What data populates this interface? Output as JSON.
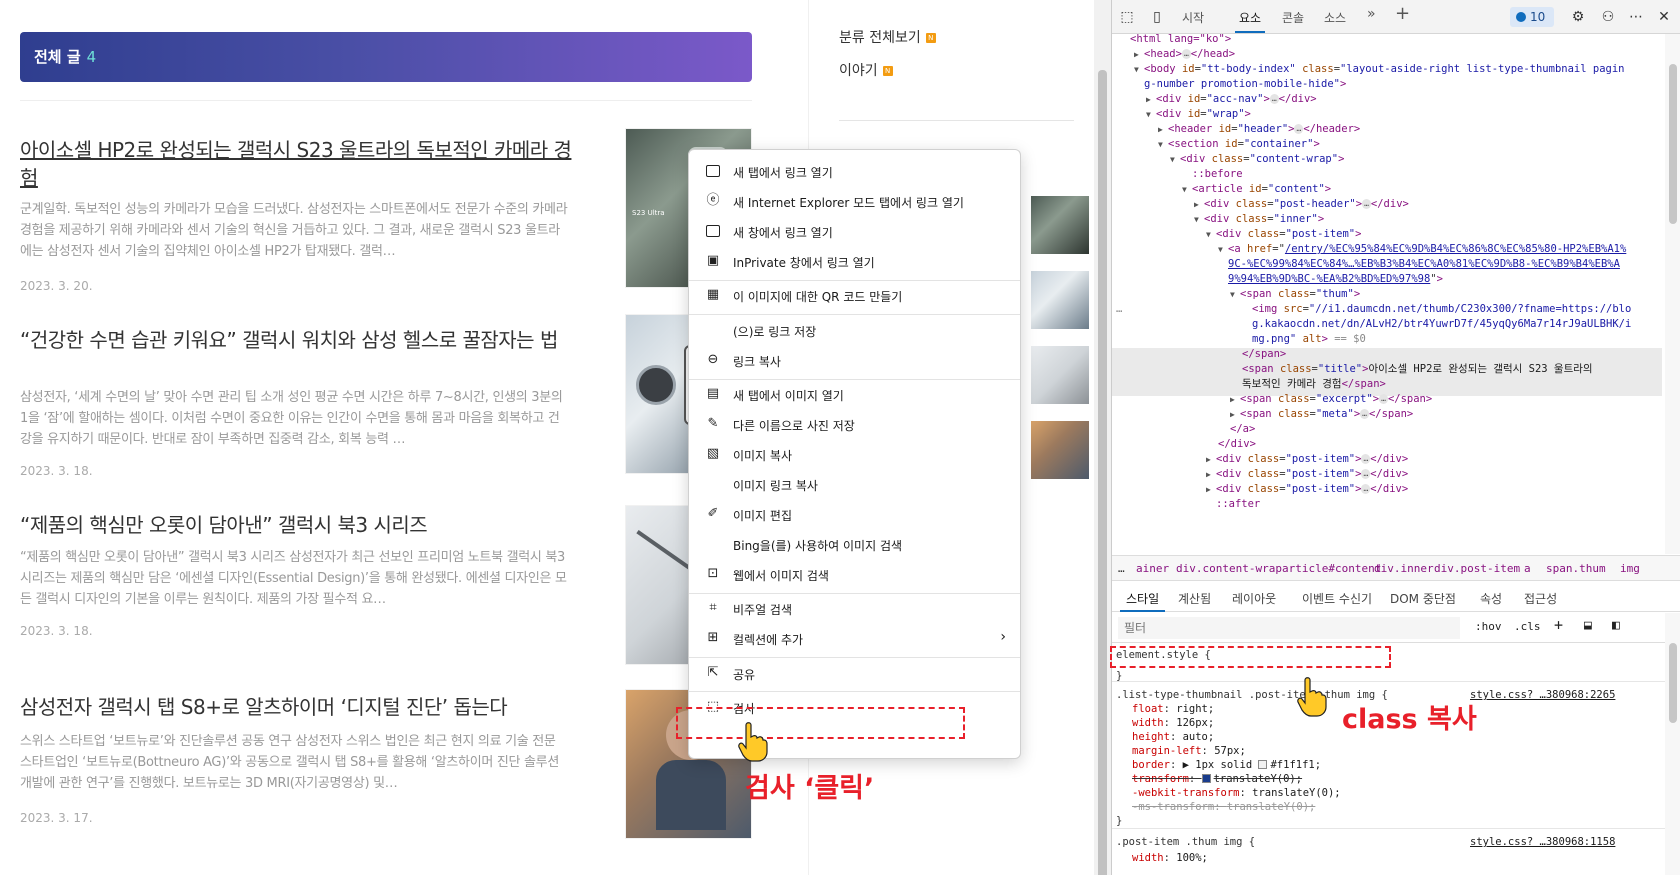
{
  "blog": {
    "banner": {
      "title": "전체 글",
      "count": "4"
    },
    "posts": [
      {
        "title": "아이소셀 HP2로 완성되는 갤럭시 S23 울트라의 독보적인 카메라 경험",
        "excerpt": "군계일학. 독보적인 성능의 카메라가 모습을 드러냈다. 삼성전자는 스마트폰에서도 전문가 수준의 카메라 경험을 제공하기 위해 카메라와 센서 기술의 혁신을 거듭하고 있다. 그 결과, 새로운 갤럭시 S23 울트라에는 삼성전자 센서 기술의 집약체인 아이소셀 HP2가 탑재됐다. 갤럭…",
        "date": "2023. 3. 20.",
        "thumb_label": "S23 Ultra"
      },
      {
        "title": "“건강한 수면 습관 키워요” 갤럭시 워치와 삼성 헬스로 꿀잠자는 법",
        "excerpt": "삼성전자, ‘세계 수면의 날’ 맞아 수면 관리 팁 소개 성인 평균 수면 시간은 하루 7~8시간, 인생의 3분의 1을 ‘잠’에 할애하는 셈이다. 이처럼 수면이 중요한 이유는 인간이 수면을 통해 몸과 마음을 회복하고 건강을 유지하기 때문이다. 반대로 잠이 부족하면 집중력 감소, 회복 능력 …",
        "date": "2023. 3. 18."
      },
      {
        "title": "“제품의 핵심만 오롯이 담아낸” 갤럭시 북3 시리즈",
        "excerpt": "“제품의 핵심만 오롯이 담아낸” 갤럭시 북3 시리즈 삼성전자가 최근 선보인 프리미엄 노트북 갤럭시 북3 시리즈는 제품의 핵심만 담은 ‘에센셜 디자인(Essential Design)’을 통해 완성됐다. 에센셜 디자인은 모든 갤럭시 디자인의 기본을 이루는 원칙이다. 제품의 가장 필수적 요…",
        "date": "2023. 3. 18."
      },
      {
        "title": "삼성전자 갤럭시 탭 S8+로 알츠하이머 ‘디지털 진단’ 돕는다",
        "excerpt": "스위스 스타트업 ‘보트뉴로’와 진단솔루션 공동 연구 삼성전자 스위스 법인은 최근 현지 의료 기술 전문 스타트업인 ‘보트뉴로(Bottneuro AG)’와 공동으로 갤럭시 탭 S8+를 활용해 ‘알츠하이머 진단 솔루션 개발에 관한 연구’를 진행했다. 보트뉴로는 3D MRI(자기공명영상) 및…",
        "date": "2023. 3. 17."
      }
    ],
    "sidebar": {
      "category_all": "분류 전체보기",
      "category_story": "이야기",
      "new_badge": "N"
    }
  },
  "context_menu": {
    "items": [
      {
        "label": "새 탭에서 링크 열기",
        "icon": "new-tab-icon"
      },
      {
        "label": "새 Internet Explorer 모드 탭에서 링크 열기",
        "icon": "ie-icon"
      },
      {
        "label": "새 창에서 링크 열기",
        "icon": "new-window-icon"
      },
      {
        "label": "InPrivate 창에서 링크 열기",
        "icon": "inprivate-icon"
      },
      {
        "label": "이 이미지에 대한 QR 코드 만들기",
        "icon": "qr-icon"
      },
      {
        "label": "(으)로 링크 저장",
        "icon": ""
      },
      {
        "label": "링크 복사",
        "icon": "link-icon"
      },
      {
        "label": "새 탭에서 이미지 열기",
        "icon": "image-tab-icon"
      },
      {
        "label": "다른 이름으로 사진 저장",
        "icon": "save-image-icon"
      },
      {
        "label": "이미지 복사",
        "icon": "copy-image-icon"
      },
      {
        "label": "이미지 링크 복사",
        "icon": ""
      },
      {
        "label": "이미지 편집",
        "icon": "edit-image-icon"
      },
      {
        "label": "Bing을(를) 사용하여 이미지 검색",
        "icon": ""
      },
      {
        "label": "웹에서 이미지 검색",
        "icon": "web-image-search-icon"
      },
      {
        "label": "비주얼 검색",
        "icon": "visual-search-icon"
      },
      {
        "label": "컬렉션에 추가",
        "icon": "collections-icon"
      },
      {
        "label": "공유",
        "icon": "share-icon"
      },
      {
        "label": "검사",
        "icon": "inspect-icon"
      }
    ],
    "submenu_arrow": "›"
  },
  "annotations": {
    "inspect_click": "검사 ‘클릭’",
    "copy_class": "class 복사",
    "color": "#e8202a"
  },
  "devtools": {
    "tabs": [
      "시작",
      "요소",
      "콘솔",
      "소스"
    ],
    "active_tab": "요소",
    "more": "»",
    "add": "+",
    "issues_count": "10",
    "dom": {
      "l1": "<html lang=\"ko\">",
      "l2_open": "<head>",
      "l2_close": "</head>",
      "l3_tag": "<body",
      "l3_id_attr": "id",
      "l3_id_val": "\"tt-body-index\"",
      "l3_class_attr": "class",
      "l3_class_val": "\"layout-aside-right list-type-thumbnail pagin",
      "l4_cont": "g-number promotion-mobile-hide\"",
      "l5_tag": "<div",
      "l5_attr": "id",
      "l5_val": "\"acc-nav\"",
      "l5_close": "</div>",
      "l6_tag": "<div",
      "l6_attr": "id",
      "l6_val": "\"wrap\"",
      "l7_tag": "<header",
      "l7_attr": "id",
      "l7_val": "\"header\"",
      "l7_close": "</header>",
      "l8_tag": "<section",
      "l8_attr": "id",
      "l8_val": "\"container\"",
      "l9_tag": "<div",
      "l9_attr": "class",
      "l9_val": "\"content-wrap\"",
      "l10": "::before",
      "l11_tag": "<article",
      "l11_attr": "id",
      "l11_val": "\"content\"",
      "l12_tag": "<div",
      "l12_attr": "class",
      "l12_val": "\"post-header\"",
      "l12_close": "</div>",
      "l13_tag": "<div",
      "l13_attr": "class",
      "l13_val": "\"inner\"",
      "l14_tag": "<div",
      "l14_attr": "class",
      "l14_val": "\"post-item\"",
      "l15_tag": "<a",
      "l15_attr": "href",
      "l15_val": "/entry/%EC%95%84%EC%9D%B4%EC%86%8C%EC%85%80-HP2%EB%A1%",
      "l16": "9C-%EC%99%84%EC%84%…%EB%B3%B4%EC%A0%81%EC%9D%B8-%EC%B9%B4%EB%A",
      "l17": "9%94%EB%9D%BC-%EA%B2%BD%ED%97%98",
      "l18_tag": "<span",
      "l18_attr": "class",
      "l18_val": "\"thum\"",
      "l19_tag": "<img",
      "l19_attr": "src",
      "l19_val": "\"//i1.daumcdn.net/thumb/C230x300/?fname=https://blo",
      "l20": "g.kakaocdn.net/dn/ALvH2/btr4YuwrD7f/45yqQy6Ma7r14rJ9aULBHK/i",
      "l21": "mg.png\"",
      "l21_alt": "alt",
      "l21_eq": "== $0",
      "l22": "</span>",
      "l23_tag": "<span",
      "l23_attr": "class",
      "l23_val": "\"title\"",
      "l23_text": "아이소셀 HP2로 완성되는 갤럭시 S23 울트라의",
      "l24_text": "독보적인 카메라 경험",
      "l24_close": "</span>",
      "l25_tag": "<span",
      "l25_attr": "class",
      "l25_val": "\"excerpt\"",
      "l25_close": "</span>",
      "l26_tag": "<span",
      "l26_attr": "class",
      "l26_val": "\"meta\"",
      "l26_close": "</span>",
      "l27": "</a>",
      "l28": "</div>",
      "l29_tag": "<div",
      "l29_attr": "class",
      "l29_val": "\"post-item\"",
      "l29_close": "</div>",
      "l32": "::after",
      "dots": "…"
    },
    "breadcrumbs": [
      "…",
      "ainer",
      "div.content-wrap",
      "article#content",
      "div.inner",
      "div.post-item",
      "a",
      "span.thum",
      "img"
    ],
    "subtabs": [
      "스타일",
      "계산됨",
      "레이아웃",
      "이벤트 수신기",
      "DOM 중단점",
      "속성",
      "접근성"
    ],
    "filter_placeholder": "필터",
    "hov": ":hov",
    "cls": ".cls",
    "styles": {
      "element_style": "element.style {",
      "close_brace": "}",
      "rule1_selector": ".list-type-thumbnail .post-item .thum img {",
      "rule1_source": "style.css? …380968:2265",
      "p1": "float",
      "v1": "right;",
      "p2": "width",
      "v2": "126px;",
      "p3": "height",
      "v3": "auto;",
      "p4": "margin-left",
      "v4": "57px;",
      "p5": "border",
      "v5": "1px solid",
      "v5b": "#f1f1f1;",
      "p6": "transform",
      "v6": "translateY(0);",
      "p7": "-webkit-transform",
      "v7": "translateY(0);",
      "p8": "-ms-transform",
      "v8": "translateY(0);",
      "rule2_selector": ".post-item .thum img {",
      "rule2_source": "style.css? …380968:1158",
      "p9": "width",
      "v9": "100%;"
    }
  }
}
